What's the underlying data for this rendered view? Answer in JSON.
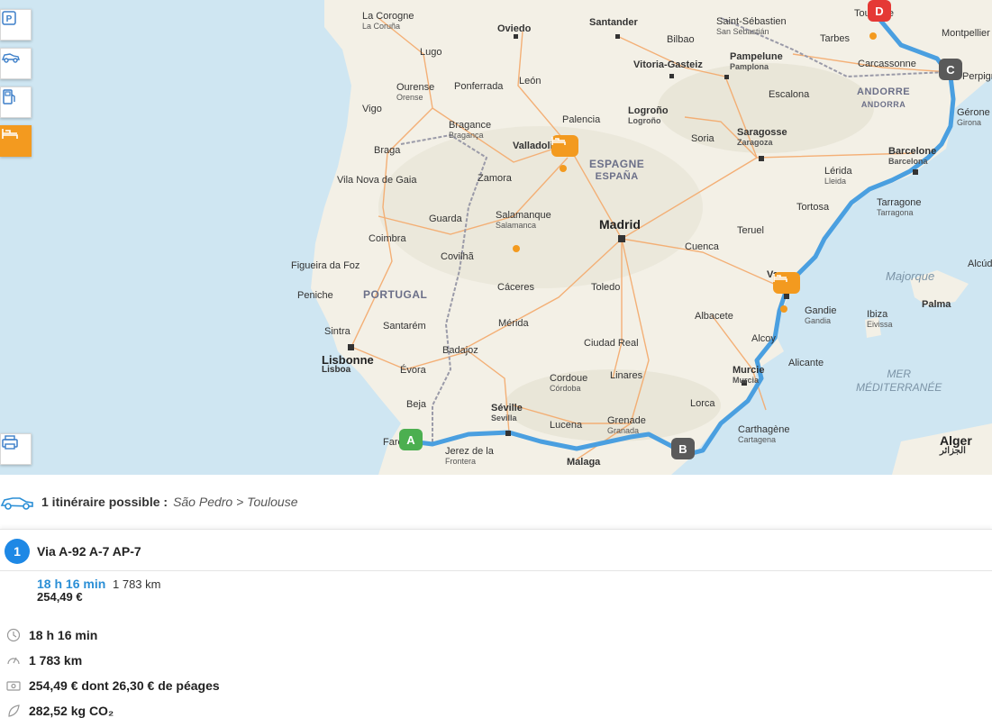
{
  "map": {
    "countries": [
      {
        "name": "ESPAGNE",
        "sub": "ESPAÑA"
      },
      {
        "name": "PORTUGAL"
      },
      {
        "name": "ANDORRE",
        "sub": "ANDORRA"
      }
    ],
    "sea": {
      "name": "MER",
      "sub": "MÉDITERRANÉE"
    },
    "island": "Majorque",
    "cities": [
      {
        "name": "La Corogne",
        "sub": "La Coruña"
      },
      {
        "name": "Oviedo"
      },
      {
        "name": "Santander"
      },
      {
        "name": "Bilbao"
      },
      {
        "name": "Saint-Sébastien",
        "sub": "San Sebastián"
      },
      {
        "name": "Toulouse"
      },
      {
        "name": "Montpellier"
      },
      {
        "name": "Tarbes"
      },
      {
        "name": "Lugo"
      },
      {
        "name": "Vitoria-Gasteiz"
      },
      {
        "name": "Pampelune",
        "sub": "Pamplona"
      },
      {
        "name": "Carcassonne"
      },
      {
        "name": "Perpignan"
      },
      {
        "name": "Ourense",
        "sub": "Orense"
      },
      {
        "name": "Ponferrada"
      },
      {
        "name": "León"
      },
      {
        "name": "Logroño",
        "sub": "Logroño"
      },
      {
        "name": "Escalona"
      },
      {
        "name": "Vigo"
      },
      {
        "name": "Bragance",
        "sub": "Bragança"
      },
      {
        "name": "Palencia"
      },
      {
        "name": "Gérone",
        "sub": "Girona"
      },
      {
        "name": "Valladolid"
      },
      {
        "name": "Soria"
      },
      {
        "name": "Saragosse",
        "sub": "Zaragoza"
      },
      {
        "name": "Braga"
      },
      {
        "name": "Barcelone",
        "sub": "Barcelona"
      },
      {
        "name": "Lérida",
        "sub": "Lleida"
      },
      {
        "name": "Vila Nova de Gaia"
      },
      {
        "name": "Zamora"
      },
      {
        "name": "Tortosa"
      },
      {
        "name": "Tarragone",
        "sub": "Tarragona"
      },
      {
        "name": "Guarda"
      },
      {
        "name": "Salamanque",
        "sub": "Salamanca"
      },
      {
        "name": "Madrid"
      },
      {
        "name": "Teruel"
      },
      {
        "name": "Coimbra"
      },
      {
        "name": "Cuenca"
      },
      {
        "name": "Covilhã"
      },
      {
        "name": "Figueira da Foz"
      },
      {
        "name": "Alcúdia"
      },
      {
        "name": "Peniche"
      },
      {
        "name": "Cáceres"
      },
      {
        "name": "Toledo"
      },
      {
        "name": "Valence"
      },
      {
        "name": "Palma"
      },
      {
        "name": "Gandie",
        "sub": "Gandia"
      },
      {
        "name": "Sintra"
      },
      {
        "name": "Santarém"
      },
      {
        "name": "Mérida"
      },
      {
        "name": "Albacete"
      },
      {
        "name": "Ibiza",
        "sub": "Eivissa"
      },
      {
        "name": "Alcoy"
      },
      {
        "name": "Ciudad Real"
      },
      {
        "name": "Lisbonne",
        "sub": "Lisboa"
      },
      {
        "name": "Badajoz"
      },
      {
        "name": "Évora"
      },
      {
        "name": "Alicante"
      },
      {
        "name": "Murcie",
        "sub": "Murcia"
      },
      {
        "name": "Cordoue",
        "sub": "Córdoba"
      },
      {
        "name": "Linares"
      },
      {
        "name": "Beja"
      },
      {
        "name": "Lorca"
      },
      {
        "name": "Séville",
        "sub": "Sevilla"
      },
      {
        "name": "Lucena"
      },
      {
        "name": "Grenade",
        "sub": "Granada"
      },
      {
        "name": "Carthagène",
        "sub": "Cartagena"
      },
      {
        "name": "Faro"
      },
      {
        "name": "Jerez de la",
        "sub": "Frontera"
      },
      {
        "name": "Malaga"
      },
      {
        "name": "Alger",
        "sub": "الجزائر"
      }
    ],
    "markers": [
      "A",
      "B",
      "C",
      "D"
    ],
    "tools": [
      {
        "name": "parking",
        "icon": "parking-icon"
      },
      {
        "name": "car-rental",
        "icon": "car-icon"
      },
      {
        "name": "fuel",
        "icon": "fuel-icon"
      },
      {
        "name": "hotel",
        "icon": "bed-icon"
      },
      {
        "name": "print",
        "icon": "printer-icon"
      }
    ]
  },
  "summary": {
    "count_label": "1 itinéraire possible :",
    "route_text": "São Pedro > Toulouse"
  },
  "route": {
    "number": "1",
    "title": "Via A-92 A-7 AP-7",
    "time": "18 h 16 min",
    "distance": "1 783 km",
    "cost": "254,49 €"
  },
  "details": {
    "time": "18 h 16 min",
    "distance": "1 783 km",
    "cost": "254,49 € dont 26,30 € de péages",
    "co2": "282,52 kg CO₂"
  },
  "colors": {
    "route": "#4a9fe0",
    "accent": "#f39a1f",
    "route_number": "#1e88e5",
    "time_text": "#2b8fd6"
  }
}
